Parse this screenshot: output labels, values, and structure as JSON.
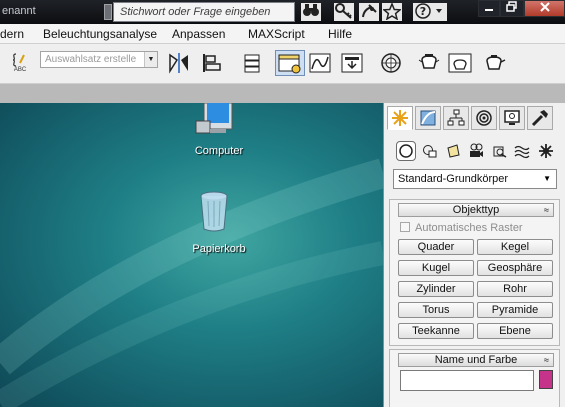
{
  "titlebar": {
    "app_title_fragment": "enannt",
    "search_placeholder": "Stichwort oder Frage eingeben",
    "icons": [
      "binoculars-icon",
      "key-icon",
      "satellite-icon",
      "star-icon",
      "help-icon"
    ],
    "window_controls": [
      "minimize",
      "restore",
      "close"
    ]
  },
  "menubar": {
    "items": [
      "dern",
      "Beleuchtungsanalyse",
      "Anpassen",
      "MAXScript",
      "Hilfe"
    ]
  },
  "toolbar": {
    "selection_set_placeholder": "Auswahlsatz erstelle",
    "abc_label": "ABC"
  },
  "desktop": {
    "icons": [
      {
        "label": "Computer"
      },
      {
        "label": "Papierkorb"
      }
    ]
  },
  "command_panel": {
    "tabs": [
      "create",
      "modify",
      "hierarchy",
      "motion",
      "display",
      "utilities"
    ],
    "category_dropdown": "Standard-Grundkörper",
    "object_type": {
      "header": "Objekttyp",
      "collapse_symbol": "≈",
      "auto_grid_label": "Automatisches Raster",
      "buttons": [
        [
          "Quader",
          "Kegel"
        ],
        [
          "Kugel",
          "Geosphäre"
        ],
        [
          "Zylinder",
          "Rohr"
        ],
        [
          "Torus",
          "Pyramide"
        ],
        [
          "Teekanne",
          "Ebene"
        ]
      ]
    },
    "name_color": {
      "header": "Name und Farbe",
      "collapse_symbol": "≈",
      "name_value": "",
      "color": "#c6338a"
    }
  }
}
